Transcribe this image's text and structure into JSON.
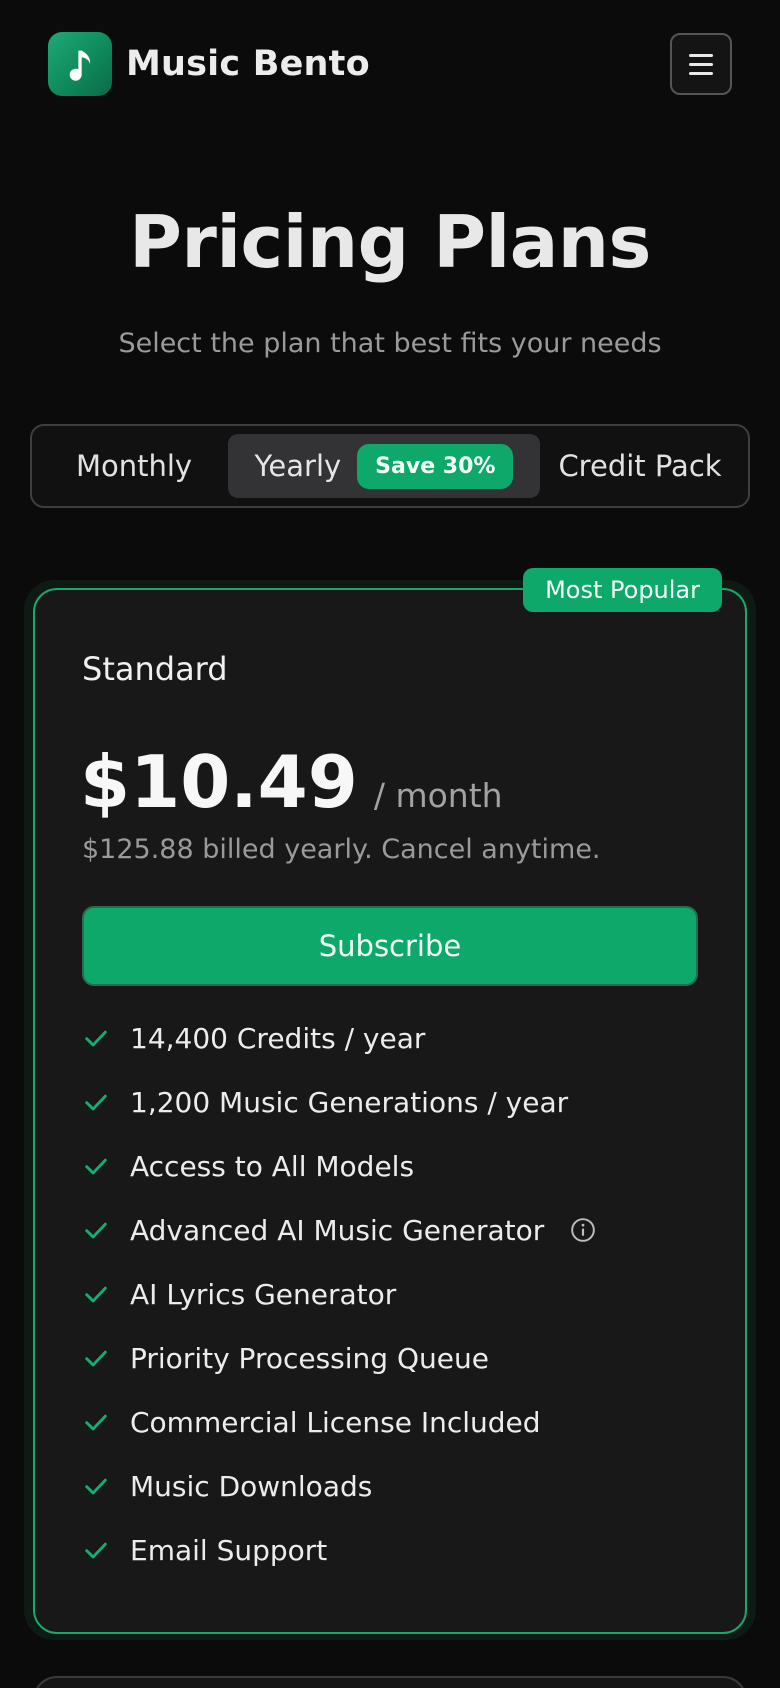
{
  "header": {
    "brand_name": "Music Bento",
    "logo_icon": "music-note-icon",
    "menu_icon": "hamburger-menu-icon"
  },
  "hero": {
    "title": "Pricing Plans",
    "subtitle": "Select the plan that best fits your needs"
  },
  "billing_toggle": {
    "options": [
      {
        "label": "Monthly",
        "selected": false
      },
      {
        "label": "Yearly",
        "selected": true,
        "badge": "Save 30%"
      },
      {
        "label": "Credit Pack",
        "selected": false
      }
    ]
  },
  "plan": {
    "badge": "Most Popular",
    "name": "Standard",
    "price": "$10.49",
    "period": "/ month",
    "billing_note": "$125.88 billed yearly. Cancel anytime.",
    "cta": "Subscribe",
    "features": [
      {
        "label": "14,400 Credits / year"
      },
      {
        "label": "1,200 Music Generations / year"
      },
      {
        "label": "Access to All Models"
      },
      {
        "label": "Advanced AI Music Generator",
        "info_icon": "info-icon"
      },
      {
        "label": "AI Lyrics Generator"
      },
      {
        "label": "Priority Processing Queue"
      },
      {
        "label": "Commercial License Included"
      },
      {
        "label": "Music Downloads"
      },
      {
        "label": "Email Support"
      }
    ]
  },
  "colors": {
    "accent": "#0ea86a",
    "background": "#0b0b0b",
    "card": "#181818"
  }
}
